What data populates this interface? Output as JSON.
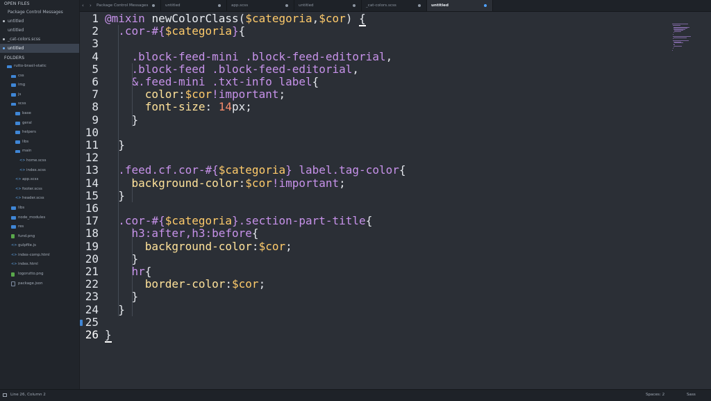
{
  "sidebar": {
    "open_files_title": "OPEN FILES",
    "open_files": [
      {
        "label": "Package Control Messages",
        "dot": false,
        "active": false
      },
      {
        "label": "untitled",
        "dot": true,
        "active": false
      },
      {
        "label": "untitled",
        "dot": false,
        "active": false
      },
      {
        "label": "_cat-colors.scss",
        "dot": true,
        "active": false
      },
      {
        "label": "untitled",
        "dot": true,
        "active": true
      }
    ],
    "folders_title": "FOLDERS",
    "tree": [
      {
        "label": "rutto-brasil-static",
        "depth": 0,
        "icon": "folder-open"
      },
      {
        "label": "css",
        "depth": 1,
        "icon": "folder-open"
      },
      {
        "label": "img",
        "depth": 1,
        "icon": "folder"
      },
      {
        "label": "js",
        "depth": 1,
        "icon": "folder"
      },
      {
        "label": "scss",
        "depth": 1,
        "icon": "folder-open"
      },
      {
        "label": "base",
        "depth": 2,
        "icon": "folder"
      },
      {
        "label": "geral",
        "depth": 2,
        "icon": "folder"
      },
      {
        "label": "helpers",
        "depth": 2,
        "icon": "folder"
      },
      {
        "label": "libs",
        "depth": 2,
        "icon": "folder"
      },
      {
        "label": "main",
        "depth": 2,
        "icon": "folder-open"
      },
      {
        "label": "home.scss",
        "depth": 3,
        "icon": "file-code"
      },
      {
        "label": "index.scss",
        "depth": 3,
        "icon": "file-code"
      },
      {
        "label": "app.scss",
        "depth": 2,
        "icon": "file-code"
      },
      {
        "label": "footer.scss",
        "depth": 2,
        "icon": "file-code"
      },
      {
        "label": "header.scss",
        "depth": 2,
        "icon": "file-code"
      },
      {
        "label": "libs",
        "depth": 1,
        "icon": "folder"
      },
      {
        "label": "node_modules",
        "depth": 1,
        "icon": "folder"
      },
      {
        "label": "res",
        "depth": 1,
        "icon": "folder"
      },
      {
        "label": "fund.png",
        "depth": 1,
        "icon": "img"
      },
      {
        "label": "gulpfile.js",
        "depth": 1,
        "icon": "file-code"
      },
      {
        "label": "index-comp.html",
        "depth": 1,
        "icon": "file-code"
      },
      {
        "label": "index.html",
        "depth": 1,
        "icon": "file-code"
      },
      {
        "label": "logorutto.png",
        "depth": 1,
        "icon": "img"
      },
      {
        "label": "package.json",
        "depth": 1,
        "icon": "file"
      }
    ]
  },
  "tabbar": {
    "nav_arrows": "‹ ›",
    "tabs": [
      {
        "label": "Package Control Messages",
        "active": false
      },
      {
        "label": "untitled",
        "active": false
      },
      {
        "label": "app.scss",
        "active": false
      },
      {
        "label": "untitled",
        "active": false
      },
      {
        "label": "_cat-colors.scss",
        "active": false
      },
      {
        "label": "untitled",
        "active": true
      }
    ]
  },
  "editor": {
    "line_numbers": [
      "1",
      "2",
      "3",
      "4",
      "5",
      "6",
      "7",
      "8",
      "9",
      "10",
      "11",
      "12",
      "13",
      "14",
      "15",
      "16",
      "17",
      "18",
      "19",
      "20",
      "21",
      "22",
      "23",
      "24",
      "25",
      "26"
    ],
    "current_line": "26",
    "lines": [
      [
        [
          "kw",
          "@mixin"
        ],
        [
          "pun",
          " "
        ],
        [
          "fn",
          "newColorClass"
        ],
        [
          "pun",
          "("
        ],
        [
          "var",
          "$categoria"
        ],
        [
          "pun",
          ","
        ],
        [
          "var",
          "$cor"
        ],
        [
          "pun",
          ") "
        ],
        [
          "cursor",
          "{"
        ]
      ],
      [
        [
          "pun",
          "  "
        ],
        [
          "sel",
          ".cor-#{"
        ],
        [
          "var",
          "$categoria"
        ],
        [
          "sel",
          "}"
        ],
        [
          "pun",
          "{"
        ]
      ],
      [],
      [
        [
          "pun",
          "    "
        ],
        [
          "sel",
          ".block-feed-mini .block-feed-editorial"
        ],
        [
          "pun",
          ","
        ]
      ],
      [
        [
          "pun",
          "    "
        ],
        [
          "sel",
          ".block-feed .block-feed-editorial"
        ],
        [
          "pun",
          ","
        ]
      ],
      [
        [
          "pun",
          "    "
        ],
        [
          "sel",
          "&.feed-mini .txt-info label"
        ],
        [
          "pun",
          "{"
        ]
      ],
      [
        [
          "pun",
          "      "
        ],
        [
          "prop",
          "color"
        ],
        [
          "pun",
          ":"
        ],
        [
          "val",
          "$cor"
        ],
        [
          "sel",
          "!important"
        ],
        [
          "pun",
          ";"
        ]
      ],
      [
        [
          "pun",
          "      "
        ],
        [
          "prop",
          "font-size"
        ],
        [
          "pun",
          ": "
        ],
        [
          "num",
          "14"
        ],
        [
          "pun",
          "px;"
        ]
      ],
      [
        [
          "pun",
          "    }"
        ]
      ],
      [],
      [
        [
          "pun",
          "  }"
        ]
      ],
      [],
      [
        [
          "pun",
          "  "
        ],
        [
          "sel",
          ".feed.cf.cor-#{"
        ],
        [
          "var",
          "$categoria"
        ],
        [
          "sel",
          "} label.tag-color"
        ],
        [
          "pun",
          "{"
        ]
      ],
      [
        [
          "pun",
          "    "
        ],
        [
          "prop",
          "background-color"
        ],
        [
          "pun",
          ":"
        ],
        [
          "val",
          "$cor"
        ],
        [
          "sel",
          "!important"
        ],
        [
          "pun",
          ";"
        ]
      ],
      [
        [
          "pun",
          "  }"
        ]
      ],
      [],
      [
        [
          "pun",
          "  "
        ],
        [
          "sel",
          ".cor-#{"
        ],
        [
          "var",
          "$categoria"
        ],
        [
          "sel",
          "}.section-part-title"
        ],
        [
          "pun",
          "{"
        ]
      ],
      [
        [
          "pun",
          "    "
        ],
        [
          "sel",
          "h3:after,h3:before"
        ],
        [
          "pun",
          "{"
        ]
      ],
      [
        [
          "pun",
          "      "
        ],
        [
          "prop",
          "background-color"
        ],
        [
          "pun",
          ":"
        ],
        [
          "val",
          "$cor"
        ],
        [
          "pun",
          ";"
        ]
      ],
      [
        [
          "pun",
          "    }"
        ]
      ],
      [
        [
          "pun",
          "    "
        ],
        [
          "sel",
          "hr"
        ],
        [
          "pun",
          "{"
        ]
      ],
      [
        [
          "pun",
          "      "
        ],
        [
          "prop",
          "border-color"
        ],
        [
          "pun",
          ":"
        ],
        [
          "val",
          "$cor"
        ],
        [
          "pun",
          ";"
        ]
      ],
      [
        [
          "pun",
          "    }"
        ]
      ],
      [
        [
          "pun",
          "  }"
        ]
      ],
      [],
      [
        [
          "cursor",
          "}"
        ]
      ]
    ]
  },
  "statusbar": {
    "position": "Line 26, Column 2",
    "spaces": "Spaces: 2",
    "syntax": "Sass"
  },
  "colors": {
    "background": "#2b2f36",
    "sidebar": "#21252b",
    "keyword": "#c792ea",
    "variable": "#ffcb6b",
    "number": "#f78c6c",
    "accent": "#4fa2ff"
  }
}
